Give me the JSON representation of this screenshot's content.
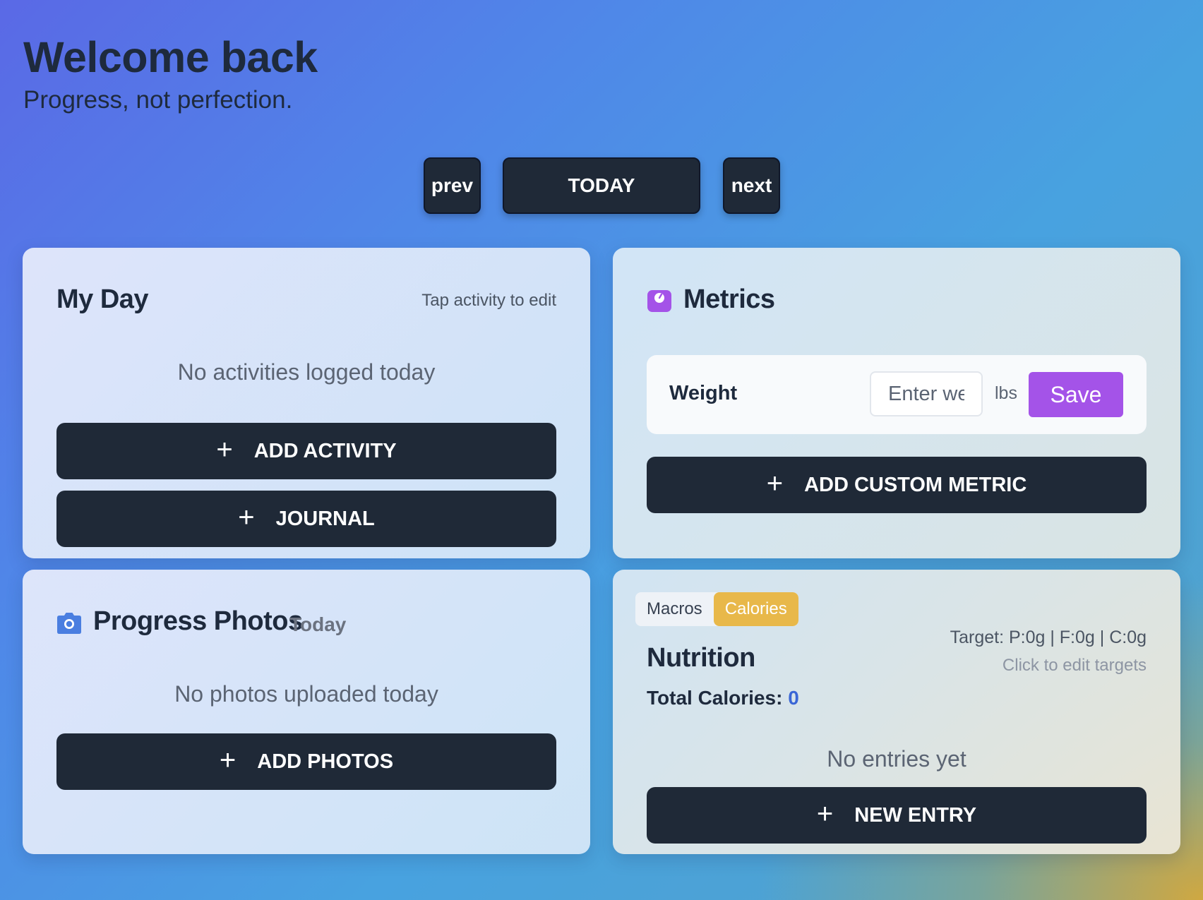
{
  "header": {
    "title": "Welcome back",
    "subtitle": "Progress, not perfection."
  },
  "nav": {
    "prev_label": "prev",
    "today_label": "TODAY",
    "next_label": "next"
  },
  "my_day": {
    "title": "My Day",
    "hint": "Tap activity to edit",
    "empty_text": "No activities logged today",
    "add_activity_label": "ADD ACTIVITY",
    "journal_label": "JOURNAL",
    "plus_glyph": "+"
  },
  "metrics": {
    "icon": "scale-icon",
    "title": "Metrics",
    "weight_label": "Weight",
    "weight_placeholder": "Enter weight",
    "weight_unit": "lbs",
    "save_label": "Save",
    "add_custom_label": "ADD CUSTOM METRIC",
    "plus_glyph": "+"
  },
  "progress_photos": {
    "icon": "camera-icon",
    "title": "Progress Photos",
    "date_tag": "Today",
    "empty_text": "No photos uploaded today",
    "add_photos_label": "ADD PHOTOS",
    "plus_glyph": "+"
  },
  "nutrition": {
    "tabs": [
      {
        "label": "Macros",
        "active": false
      },
      {
        "label": "Calories",
        "active": true
      }
    ],
    "title": "Nutrition",
    "total_label": "Total Calories:",
    "total_value": "0",
    "target_text": "Target: P:0g | F:0g | C:0g",
    "edit_targets_text": "Click to edit targets",
    "empty_text": "No entries yet",
    "new_entry_label": "NEW ENTRY",
    "plus_glyph": "+"
  },
  "colors": {
    "dark_button": "#1f2937",
    "accent_purple": "#a453e8",
    "accent_gold": "#e8b84a",
    "accent_blue": "#3a66d6"
  }
}
